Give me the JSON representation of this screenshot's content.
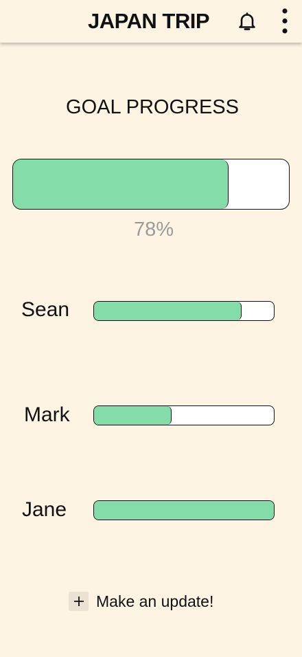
{
  "header": {
    "title": "JAPAN TRIP",
    "icons": [
      "bell-icon",
      "more-vertical-icon"
    ]
  },
  "goal": {
    "heading": "GOAL PROGRESS",
    "progress": 0.78,
    "percent_label": "78%"
  },
  "members": [
    {
      "name": "Sean",
      "progress": 0.82
    },
    {
      "name": "Mark",
      "progress": 0.43
    },
    {
      "name": "Jane",
      "progress": 1.0
    }
  ],
  "update_action": {
    "label": "Make an update!",
    "icon": "plus-icon"
  },
  "colors": {
    "background": "#fdf4e4",
    "progress_fill": "#84dca8",
    "track": "#ffffff",
    "percent_text": "#9b9b9b",
    "plus_button_bg": "#ece2d3"
  }
}
